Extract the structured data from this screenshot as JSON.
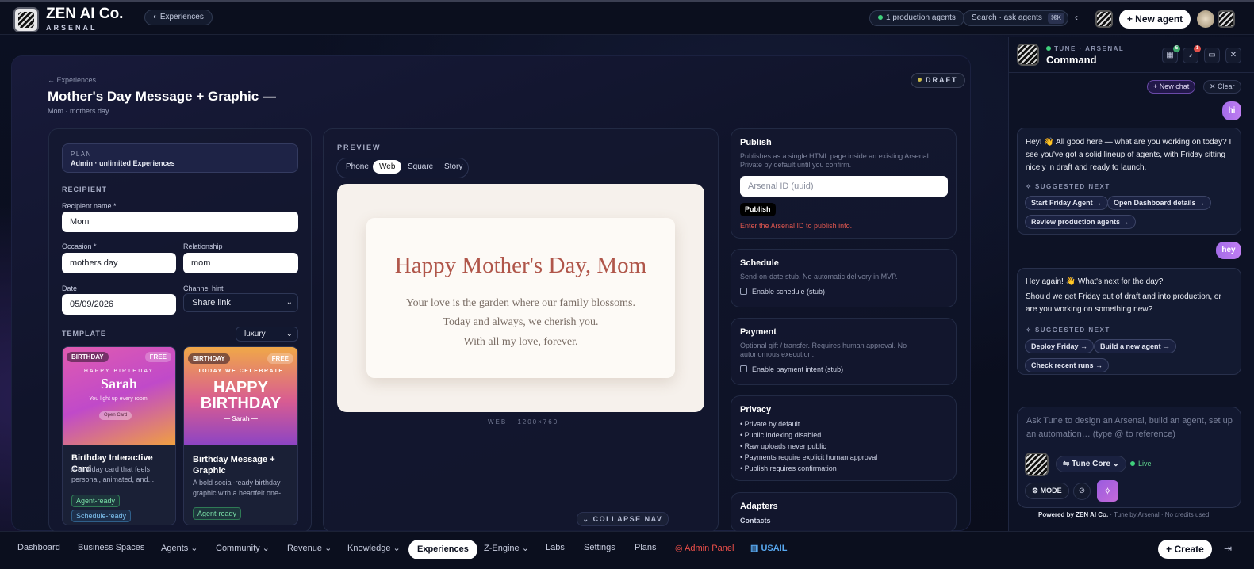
{
  "header": {
    "brand": "ZEN AI Co.",
    "brand_sub": "ARSENAL",
    "experiences_pill": "Experiences",
    "production_agents": "1 production agents",
    "search_label": "Search · ask agents",
    "search_shortcut": "⌘K",
    "new_agent": "New agent"
  },
  "page": {
    "back": "← Experiences",
    "title": "Mother's Day Message + Graphic —",
    "subtitle": "Mom · mothers day",
    "status": "DRAFT"
  },
  "form": {
    "plan_label": "PLAN",
    "plan_value": "Admin · unlimited Experiences",
    "recipient_section": "RECIPIENT",
    "recipient_name_label": "Recipient name *",
    "recipient_name_value": "Mom",
    "occasion_label": "Occasion *",
    "occasion_value": "mothers day",
    "relationship_label": "Relationship",
    "relationship_value": "mom",
    "date_label": "Date",
    "date_value": "05/09/2026",
    "channel_label": "Channel hint",
    "channel_value": "Share link",
    "template_section": "TEMPLATE",
    "template_style": "luxury"
  },
  "templates": [
    {
      "category": "BIRTHDAY",
      "price": "FREE",
      "art_kicker": "HAPPY BIRTHDAY",
      "art_name": "Sarah",
      "art_line": "You light up every room.",
      "art_button": "Open Card",
      "title": "Birthday Interactive Card",
      "desc": "A birthday card that feels personal, animated, and...",
      "chips": [
        "Agent-ready",
        "Schedule-ready"
      ]
    },
    {
      "category": "BIRTHDAY",
      "price": "FREE",
      "art_kicker": "TODAY WE CELEBRATE",
      "art_big1": "HAPPY",
      "art_big2": "BIRTHDAY",
      "art_name": "— Sarah —",
      "title": "Birthday Message + Graphic",
      "desc": "A bold social-ready birthday graphic with a heartfelt one-...",
      "chips": [
        "Agent-ready"
      ]
    }
  ],
  "preview": {
    "label": "PREVIEW",
    "tabs": [
      "Phone",
      "Web",
      "Square",
      "Story"
    ],
    "active_tab": "Web",
    "headline": "Happy Mother's Day, Mom",
    "lines": [
      "Your love is the garden where our family blossoms.",
      "Today and always, we cherish you.",
      "With all my love, forever."
    ],
    "size_label": "WEB · 1200×760",
    "collapse": "COLLAPSE NAV"
  },
  "publish": {
    "title": "Publish",
    "desc": "Publishes as a single HTML page inside an existing Arsenal. Private by default until you confirm.",
    "placeholder": "Arsenal ID (uuid)",
    "button": "Publish",
    "error": "Enter the Arsenal ID to publish into."
  },
  "schedule": {
    "title": "Schedule",
    "desc": "Send-on-date stub. No automatic delivery in MVP.",
    "checkbox": "Enable schedule (stub)"
  },
  "payment": {
    "title": "Payment",
    "desc": "Optional gift / transfer. Requires human approval. No autonomous execution.",
    "checkbox": "Enable payment intent (stub)"
  },
  "privacy": {
    "title": "Privacy",
    "items": [
      "• Private by default",
      "• Public indexing disabled",
      "• Raw uploads never public",
      "• Payments require explicit human approval",
      "• Publish requires confirmation"
    ]
  },
  "adapters": {
    "title": "Adapters",
    "first": "Contacts"
  },
  "command": {
    "kicker": "TUNE · ARSENAL",
    "title": "Command",
    "badge_a": "5",
    "badge_b": "1",
    "new_chat": "New chat",
    "clear": "Clear",
    "user_msg_1": "hi",
    "assistant_1": "Hey! 👋 All good here — what are you working on today? I see you've got a solid lineup of agents, with Friday sitting nicely in draft and ready to launch.",
    "suggested_label": "SUGGESTED NEXT",
    "suggestions_1": [
      "Start Friday Agent →",
      "Open Dashboard details →",
      "Review production agents →"
    ],
    "user_msg_2": "hey",
    "assistant_2a": "Hey again! 👋 What's next for the day?",
    "assistant_2b": "Should we get Friday out of draft and into production, or are you working on something new?",
    "suggestions_2": [
      "Deploy Friday →",
      "Build a new agent →",
      "Check recent runs →"
    ],
    "composer_placeholder": "Ask Tune to design an Arsenal, build an agent, set up an automation… (type @ to reference)",
    "model": "Tune Core",
    "live": "Live",
    "mode": "MODE",
    "powered_by": "Powered by ZEN AI Co.",
    "powered_rest": "· Tune by Arsenal · No credits used"
  },
  "nav": {
    "items": [
      "Dashboard",
      "Business Spaces",
      "Agents ⌄",
      "Community ⌄",
      "Revenue ⌄",
      "Knowledge ⌄",
      "Experiences",
      "Z-Engine ⌄",
      "Labs",
      "Settings",
      "Plans",
      "Admin Panel",
      "USAIL"
    ],
    "active": "Experiences",
    "create": "Create"
  },
  "colors": {
    "accent_purple": "#a46ce8",
    "error_red": "#e0574f",
    "preview_title": "#b0564a",
    "live_green": "#3fd07c"
  }
}
